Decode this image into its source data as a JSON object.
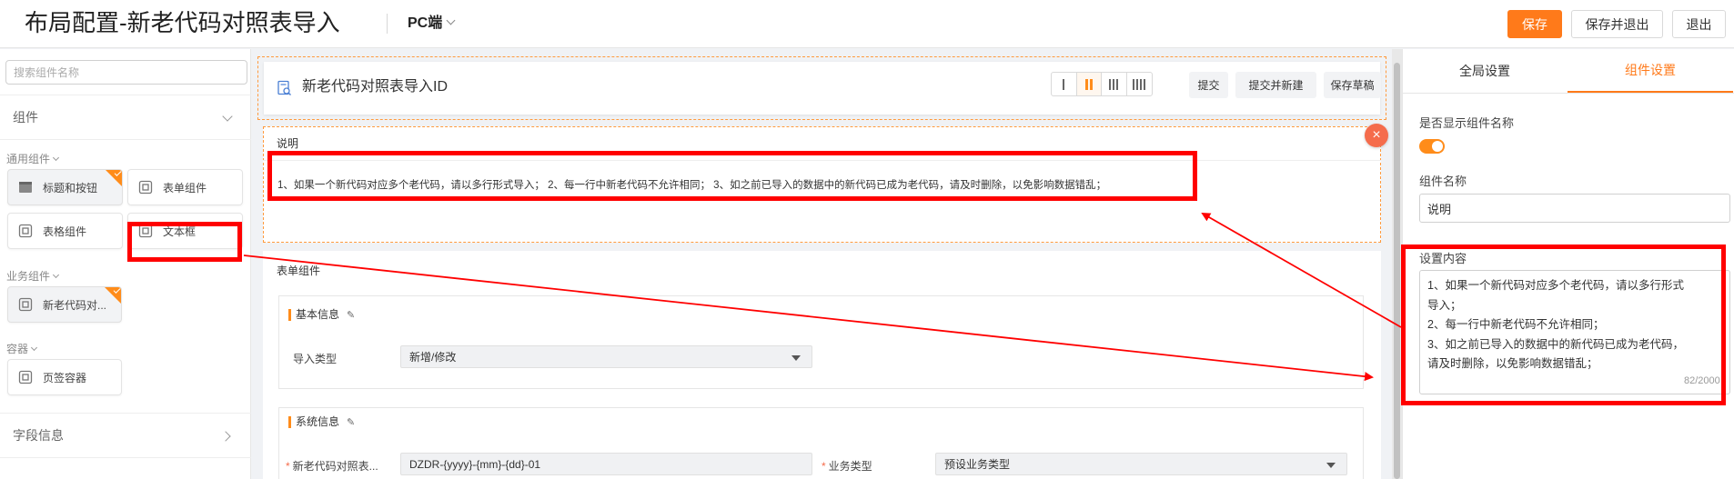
{
  "header": {
    "title": "布局配置-新老代码对照表导入",
    "platform": "PC端",
    "save": "保存",
    "save_exit": "保存并退出",
    "exit": "退出"
  },
  "sidebar": {
    "search_placeholder": "搜索组件名称",
    "components_head": "组件",
    "groups": {
      "common": "通用组件",
      "business": "业务组件",
      "container": "容器"
    },
    "items": {
      "title_button": "标题和按钮",
      "form_component": "表单组件",
      "table_component": "表格组件",
      "text_box": "文本框",
      "biz_item": "新老代码对...",
      "tab_container": "页签容器"
    },
    "field_info": "字段信息"
  },
  "canvas": {
    "form_title": "新老代码对照表导入ID",
    "submit": "提交",
    "submit_new": "提交并新建",
    "save_draft": "保存草稿",
    "desc_label": "说明",
    "desc_text": "1、如果一个新代码对应多个老代码，请以多行形式导入；  2、每一行中新老代码不允许相同；  3、如之前已导入的数据中的新代码已成为老代码，请及时删除，以免影响数据错乱；",
    "close": "×",
    "table_label": "表单组件",
    "basic_group": "基本信息",
    "import_type_label": "导入类型",
    "import_type_value": "新增/修改",
    "system_group": "系统信息",
    "code_field_label": "新老代码对照表...",
    "code_field_value": "DZDR-{yyyy}-{mm}-{dd}-01",
    "biz_type_label": "业务类型",
    "biz_type_value": "预设业务类型",
    "edit_glyph": "✎"
  },
  "right_panel": {
    "tab_global": "全局设置",
    "tab_component": "组件设置",
    "show_name_label": "是否显示组件名称",
    "show_name_on": true,
    "name_label": "组件名称",
    "name_value": "说明",
    "content_label": "设置内容",
    "content_line1": "1、如果一个新代码对应多个老代码，请以多行形式",
    "content_line2": "导入；",
    "content_line3": "2、每一行中新老代码不允许相同；",
    "content_line4": "3、如之前已导入的数据中的新代码已成为老代码，",
    "content_line5": "请及时删除，以免影响数据错乱；",
    "char_count": "82/2000"
  },
  "colors": {
    "accent": "#ff7a1a",
    "annotation": "#ff0000"
  }
}
